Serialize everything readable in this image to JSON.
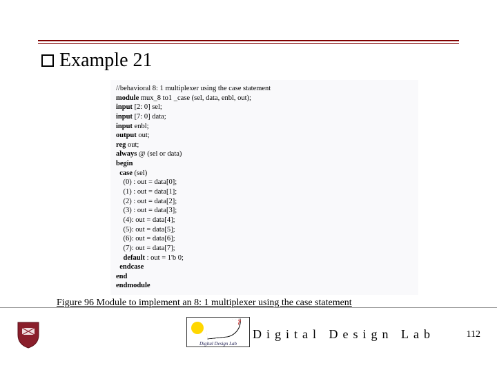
{
  "title": "Example 21",
  "code": {
    "comment": "//behavioral 8: 1 multiplexer using the case statement",
    "kw_module": "module",
    "module_line": " mux_8 to1 _case (sel, data, enbl, out);",
    "kw_input": "input",
    "sel_line": " [2: 0] sel;",
    "data_line": " [7: 0] data;",
    "enbl_line": " enbl;",
    "kw_output": "output",
    "out_decl": " out;",
    "kw_reg": "reg",
    "reg_line": " out;",
    "kw_always": "always",
    "always_line": " @ (sel or data)",
    "kw_begin": "begin",
    "kw_case": "case",
    "case_line": " (sel)",
    "c0": "(0) : out = data[0];",
    "c1": "(1) : out = data[1];",
    "c2": "(2) : out = data[2];",
    "c3": "(3) : out = data[3];",
    "c4": "(4): out = data[4];",
    "c5": "(5): out = data[5];",
    "c6": "(6): out = data[6];",
    "c7": "(7): out = data[7];",
    "kw_default": "default",
    "default_line": " : out = 1'b 0;",
    "kw_endcase": "endcase",
    "kw_end": "end",
    "kw_endmodule": "endmodule"
  },
  "caption": "Figure 96 Module to implement an 8: 1 multiplexer using the case statement",
  "footer": {
    "diagram_label": "Digital Design Lab",
    "diagram_q": "?",
    "brand": "Digital Design Lab",
    "page": "112"
  }
}
